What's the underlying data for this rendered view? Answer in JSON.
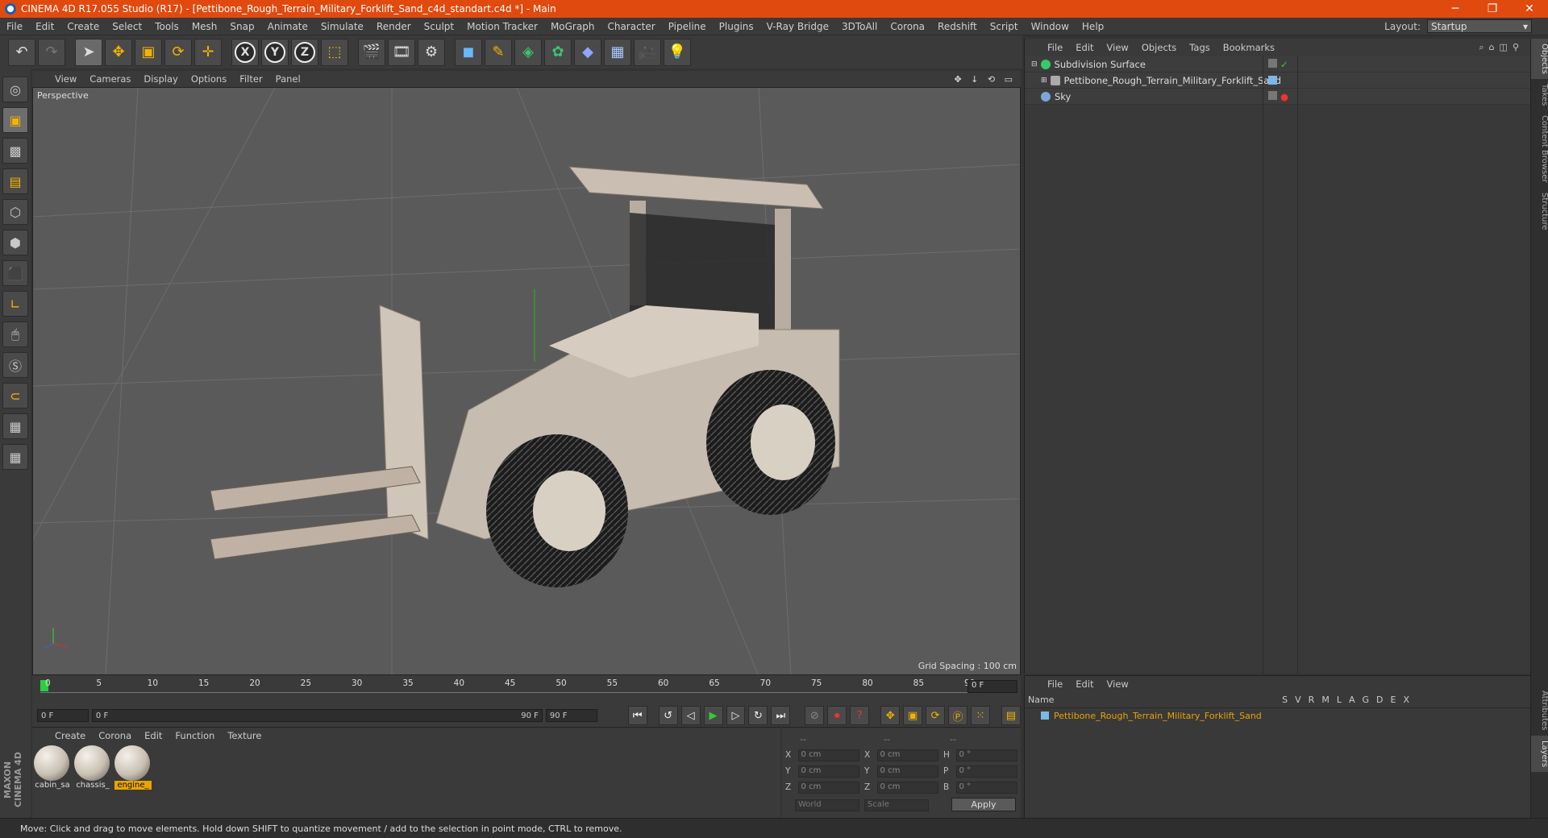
{
  "app": {
    "title": "CINEMA 4D R17.055 Studio (R17) - [Pettibone_Rough_Terrain_Military_Forklift_Sand_c4d_standart.c4d *] - Main"
  },
  "menu": [
    "File",
    "Edit",
    "Create",
    "Select",
    "Tools",
    "Mesh",
    "Snap",
    "Animate",
    "Simulate",
    "Render",
    "Sculpt",
    "Motion Tracker",
    "MoGraph",
    "Character",
    "Pipeline",
    "Plugins",
    "V-Ray Bridge",
    "3DToAll",
    "Corona",
    "Redshift",
    "Script",
    "Window",
    "Help"
  ],
  "layout": {
    "label": "Layout:",
    "value": "Startup"
  },
  "toolbar": {
    "axis_x": "X",
    "axis_y": "Y",
    "axis_z": "Z"
  },
  "viewport": {
    "menu": [
      "View",
      "Cameras",
      "Display",
      "Options",
      "Filter",
      "Panel"
    ],
    "camera": "Perspective",
    "grid_spacing": "Grid Spacing : 100 cm",
    "nav": "✥ ↓ ⟲ ▭"
  },
  "timeline": {
    "ticks": [
      "0",
      "5",
      "10",
      "15",
      "20",
      "25",
      "30",
      "35",
      "40",
      "45",
      "50",
      "55",
      "60",
      "65",
      "70",
      "75",
      "80",
      "85",
      "90"
    ],
    "current_frame": "0 F",
    "start": "0 F",
    "range_start": "0 F",
    "range_end": "90 F",
    "end": "90 F"
  },
  "materials": {
    "menu": [
      "Create",
      "Corona",
      "Edit",
      "Function",
      "Texture"
    ],
    "items": [
      {
        "name": "cabin_sa"
      },
      {
        "name": "chassis_"
      },
      {
        "name": "engine_"
      }
    ]
  },
  "coordinates": {
    "header": [
      "--",
      "--",
      "--"
    ],
    "rows": [
      {
        "l1": "X",
        "v1": "0 cm",
        "l2": "X",
        "v2": "0 cm",
        "l3": "H",
        "v3": "0 °"
      },
      {
        "l1": "Y",
        "v1": "0 cm",
        "l2": "Y",
        "v2": "0 cm",
        "l3": "P",
        "v3": "0 °"
      },
      {
        "l1": "Z",
        "v1": "0 cm",
        "l2": "Z",
        "v2": "0 cm",
        "l3": "B",
        "v3": "0 °"
      }
    ],
    "mode1": "World",
    "mode2": "Scale",
    "apply": "Apply"
  },
  "objects": {
    "menu": [
      "File",
      "Edit",
      "View",
      "Objects",
      "Tags",
      "Bookmarks"
    ],
    "rows": [
      {
        "name": "Subdivision Surface",
        "color": "#33cc66"
      },
      {
        "name": "Pettibone_Rough_Terrain_Military_Forklift_Sand",
        "color": "#aaaaaa"
      },
      {
        "name": "Sky",
        "color": "#7aa7d8"
      }
    ]
  },
  "layers": {
    "menu": [
      "File",
      "Edit",
      "View"
    ],
    "name_col": "Name",
    "cols": [
      "S",
      "V",
      "R",
      "M",
      "L",
      "A",
      "G",
      "D",
      "E",
      "X"
    ],
    "row": "Pettibone_Rough_Terrain_Military_Forklift_Sand"
  },
  "side_tabs": [
    "Objects",
    "Takes",
    "Content Browser",
    "Structure"
  ],
  "side_tabs_bottom": [
    "Attributes",
    "Layers"
  ],
  "status": "Move: Click and drag to move elements. Hold down SHIFT to quantize movement / add to the selection in point mode, CTRL to remove."
}
